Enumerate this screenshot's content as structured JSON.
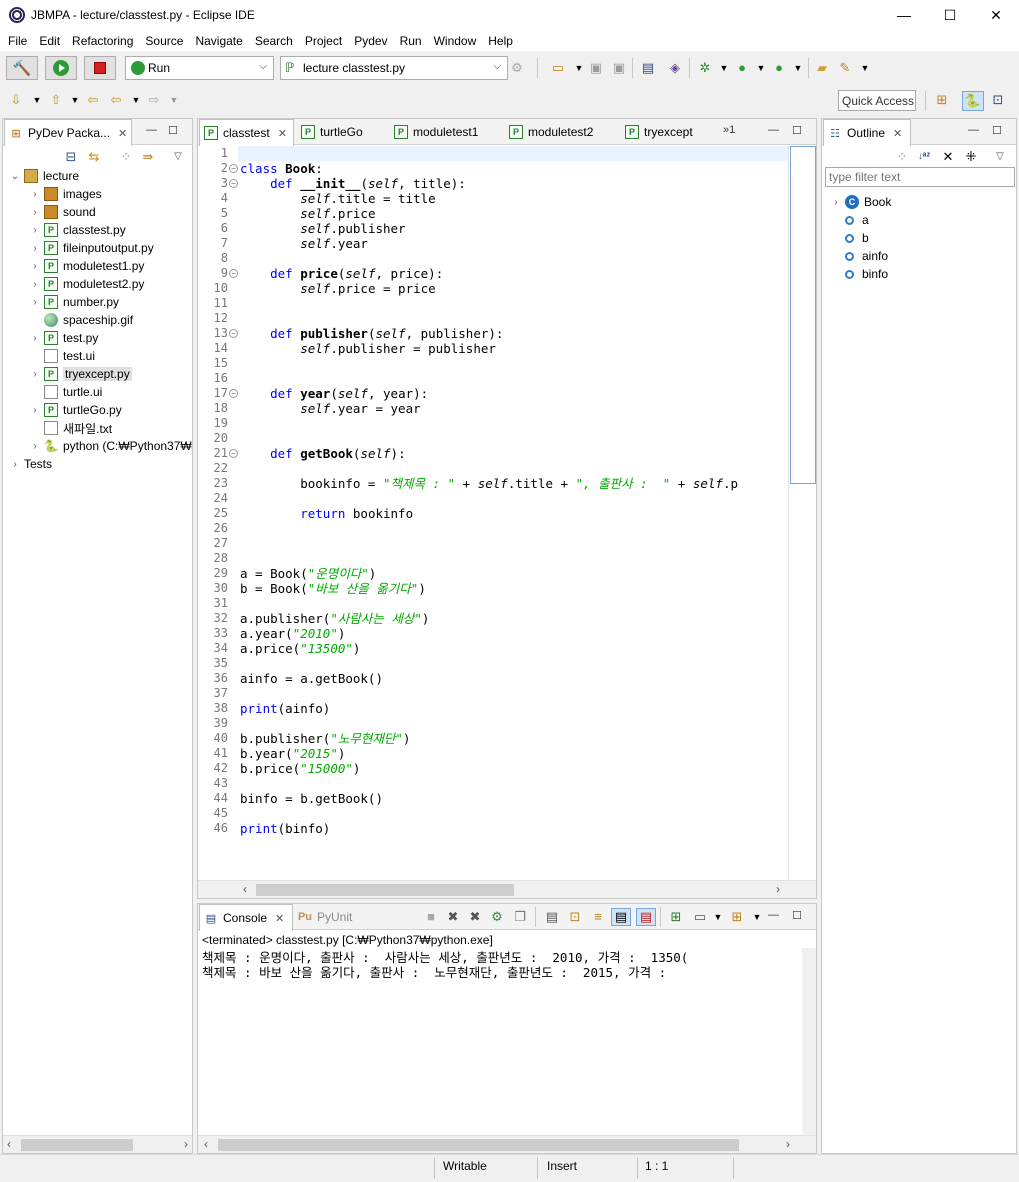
{
  "window": {
    "title": "JBMPA - lecture/classtest.py - Eclipse IDE",
    "minimize": "—",
    "maximize": "☐",
    "close": "✕"
  },
  "menu": [
    "File",
    "Edit",
    "Refactoring",
    "Source",
    "Navigate",
    "Search",
    "Project",
    "Pydev",
    "Run",
    "Window",
    "Help"
  ],
  "toolbar": {
    "launch_mode": "Run",
    "launch_config": "lecture classtest.py",
    "quick_access": "Quick Access"
  },
  "package_explorer": {
    "title": "PyDev Packa...",
    "items": [
      {
        "label": "lecture",
        "icon": "project-folder-icon",
        "depth": 0,
        "expanded": true
      },
      {
        "label": "images",
        "icon": "package-folder-icon",
        "depth": 1
      },
      {
        "label": "sound",
        "icon": "package-folder-icon",
        "depth": 1
      },
      {
        "label": "classtest.py",
        "icon": "python-file-icon",
        "depth": 1
      },
      {
        "label": "fileinputoutput.py",
        "icon": "python-file-icon",
        "depth": 1
      },
      {
        "label": "moduletest1.py",
        "icon": "python-file-icon",
        "depth": 1
      },
      {
        "label": "moduletest2.py",
        "icon": "python-file-icon",
        "depth": 1
      },
      {
        "label": "number.py",
        "icon": "python-file-icon",
        "depth": 1
      },
      {
        "label": "spaceship.gif",
        "icon": "image-file-icon",
        "depth": 1,
        "leaf": true
      },
      {
        "label": "test.py",
        "icon": "python-file-icon",
        "depth": 1
      },
      {
        "label": "test.ui",
        "icon": "text-file-icon",
        "depth": 1,
        "leaf": true
      },
      {
        "label": "tryexcept.py",
        "icon": "python-file-icon",
        "depth": 1,
        "selected": true
      },
      {
        "label": "turtle.ui",
        "icon": "text-file-icon",
        "depth": 1,
        "leaf": true
      },
      {
        "label": "turtleGo.py",
        "icon": "python-file-warning-icon",
        "depth": 1
      },
      {
        "label": "새파일.txt",
        "icon": "text-file-icon",
        "depth": 1,
        "leaf": true
      },
      {
        "label": "python   (C:₩Python37₩",
        "icon": "python-interpreter-icon",
        "depth": 1
      },
      {
        "label": "Tests",
        "icon": "none",
        "depth": 0
      }
    ]
  },
  "editor": {
    "tabs": [
      {
        "label": "classtest",
        "active": true
      },
      {
        "label": "turtleGo"
      },
      {
        "label": "moduletest1"
      },
      {
        "label": "moduletest2"
      },
      {
        "label": "tryexcept"
      }
    ],
    "overflow": "»1",
    "lines": [
      [],
      [
        [
          "kw",
          "class "
        ],
        [
          "kwb",
          "Book"
        ],
        [
          "",
          ":"
        ]
      ],
      [
        [
          "",
          "    "
        ],
        [
          "kw",
          "def "
        ],
        [
          "kwb",
          "__init__"
        ],
        [
          "",
          "("
        ],
        [
          "slf",
          "self"
        ],
        [
          "",
          ", title):"
        ]
      ],
      [
        [
          "",
          "        "
        ],
        [
          "slf",
          "self"
        ],
        [
          "",
          ".title = title"
        ]
      ],
      [
        [
          "",
          "        "
        ],
        [
          "slf",
          "self"
        ],
        [
          "",
          ".price"
        ]
      ],
      [
        [
          "",
          "        "
        ],
        [
          "slf",
          "self"
        ],
        [
          "",
          ".publisher"
        ]
      ],
      [
        [
          "",
          "        "
        ],
        [
          "slf",
          "self"
        ],
        [
          "",
          ".year"
        ]
      ],
      [],
      [
        [
          "",
          "    "
        ],
        [
          "kw",
          "def "
        ],
        [
          "kwb",
          "price"
        ],
        [
          "",
          "("
        ],
        [
          "slf",
          "self"
        ],
        [
          "",
          ", price):"
        ]
      ],
      [
        [
          "",
          "        "
        ],
        [
          "slf",
          "self"
        ],
        [
          "",
          ".price = price"
        ]
      ],
      [],
      [],
      [
        [
          "",
          "    "
        ],
        [
          "kw",
          "def "
        ],
        [
          "kwb",
          "publisher"
        ],
        [
          "",
          "("
        ],
        [
          "slf",
          "self"
        ],
        [
          "",
          ", publisher):"
        ]
      ],
      [
        [
          "",
          "        "
        ],
        [
          "slf",
          "self"
        ],
        [
          "",
          ".publisher = publisher"
        ]
      ],
      [],
      [],
      [
        [
          "",
          "    "
        ],
        [
          "kw",
          "def "
        ],
        [
          "kwb",
          "year"
        ],
        [
          "",
          "("
        ],
        [
          "slf",
          "self"
        ],
        [
          "",
          ", year):"
        ]
      ],
      [
        [
          "",
          "        "
        ],
        [
          "slf",
          "self"
        ],
        [
          "",
          ".year = year"
        ]
      ],
      [],
      [],
      [
        [
          "",
          "    "
        ],
        [
          "kw",
          "def "
        ],
        [
          "kwb",
          "getBook"
        ],
        [
          "",
          "("
        ],
        [
          "slf",
          "self"
        ],
        [
          "",
          "):"
        ]
      ],
      [],
      [
        [
          "",
          "        bookinfo = "
        ],
        [
          "str",
          "\"책제목 : \""
        ],
        [
          "",
          " + "
        ],
        [
          "slf",
          "self"
        ],
        [
          "",
          ".title + "
        ],
        [
          "str",
          "\", 출판사 :  \""
        ],
        [
          "",
          " + "
        ],
        [
          "slf",
          "self"
        ],
        [
          "",
          ".p"
        ]
      ],
      [],
      [
        [
          "",
          "        "
        ],
        [
          "kw",
          "return"
        ],
        [
          "",
          " bookinfo"
        ]
      ],
      [],
      [],
      [],
      [
        [
          "",
          "a = Book("
        ],
        [
          "str",
          "\"운명이다\""
        ],
        [
          "",
          ")"
        ]
      ],
      [
        [
          "",
          "b = Book("
        ],
        [
          "str",
          "\"바보 산을 옮기다\""
        ],
        [
          "",
          ")"
        ]
      ],
      [],
      [
        [
          "",
          "a.publisher("
        ],
        [
          "str",
          "\"사람사는 세상\""
        ],
        [
          "",
          ")"
        ]
      ],
      [
        [
          "",
          "a.year("
        ],
        [
          "str",
          "\"2010\""
        ],
        [
          "",
          ")"
        ]
      ],
      [
        [
          "",
          "a.price("
        ],
        [
          "str",
          "\"13500\""
        ],
        [
          "",
          ")"
        ]
      ],
      [],
      [
        [
          "",
          "ainfo = a.getBook()"
        ]
      ],
      [],
      [
        [
          "kw",
          "print"
        ],
        [
          "",
          "(ainfo)"
        ]
      ],
      [],
      [
        [
          "",
          "b.publisher("
        ],
        [
          "str",
          "\"노무현재단\""
        ],
        [
          "",
          ")"
        ]
      ],
      [
        [
          "",
          "b.year("
        ],
        [
          "str",
          "\"2015\""
        ],
        [
          "",
          ")"
        ]
      ],
      [
        [
          "",
          "b.price("
        ],
        [
          "str",
          "\"15000\""
        ],
        [
          "",
          ")"
        ]
      ],
      [],
      [
        [
          "",
          "binfo = b.getBook()"
        ]
      ],
      [],
      [
        [
          "kw",
          "print"
        ],
        [
          "",
          "(binfo)"
        ]
      ]
    ],
    "fold_lines": [
      2,
      3,
      9,
      13,
      17,
      21
    ]
  },
  "outline": {
    "title": "Outline",
    "filter_placeholder": "type filter text",
    "items": [
      {
        "label": "Book",
        "kind": "class"
      },
      {
        "label": "a",
        "kind": "attr"
      },
      {
        "label": "b",
        "kind": "attr"
      },
      {
        "label": "ainfo",
        "kind": "attr"
      },
      {
        "label": "binfo",
        "kind": "attr"
      }
    ]
  },
  "console": {
    "tabs": [
      {
        "label": "Console",
        "active": true
      },
      {
        "label": "PyUnit"
      }
    ],
    "header": "<terminated> classtest.py [C:₩Python37₩python.exe]",
    "output": [
      "책제목 : 운명이다, 출판사 :  사람사는 세상, 출판년도 :  2010, 가격 :  1350(",
      "책제목 : 바보 산을 옮기다, 출판사 :  노무현재단, 출판년도 :  2015, 가격 :"
    ]
  },
  "status": {
    "mode": "Writable",
    "insert": "Insert",
    "position": "1 : 1"
  }
}
